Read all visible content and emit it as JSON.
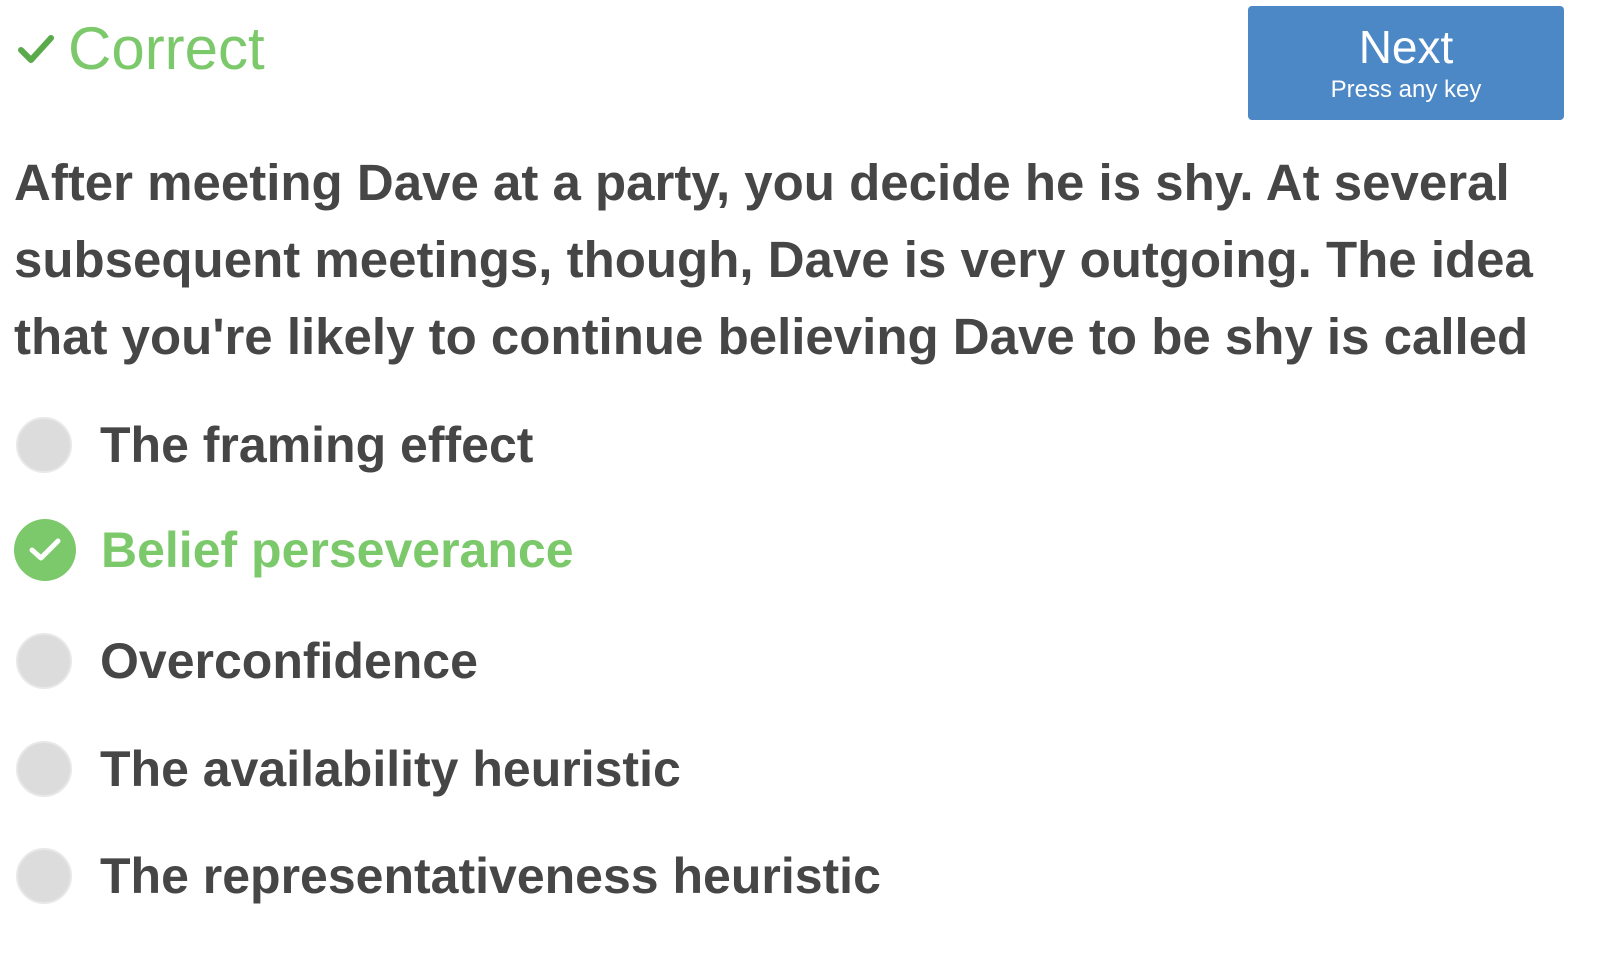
{
  "status": {
    "icon": "check-icon",
    "text": "Correct",
    "color": "#7cc96b"
  },
  "next_button": {
    "label": "Next",
    "hint": "Press any key",
    "color": "#4d88c6"
  },
  "question": {
    "text": "After meeting Dave at a party, you decide he is shy. At several subsequent meetings, though, Dave is very outgoing. The idea that you're likely to continue believing Dave to be shy is called"
  },
  "options": [
    {
      "label": "The framing effect",
      "state": "unselected"
    },
    {
      "label": "Belief perseverance",
      "state": "correct"
    },
    {
      "label": "Overconfidence",
      "state": "unselected"
    },
    {
      "label": "The availability heuristic",
      "state": "unselected"
    },
    {
      "label": "The representativeness heuristic",
      "state": "unselected"
    }
  ]
}
